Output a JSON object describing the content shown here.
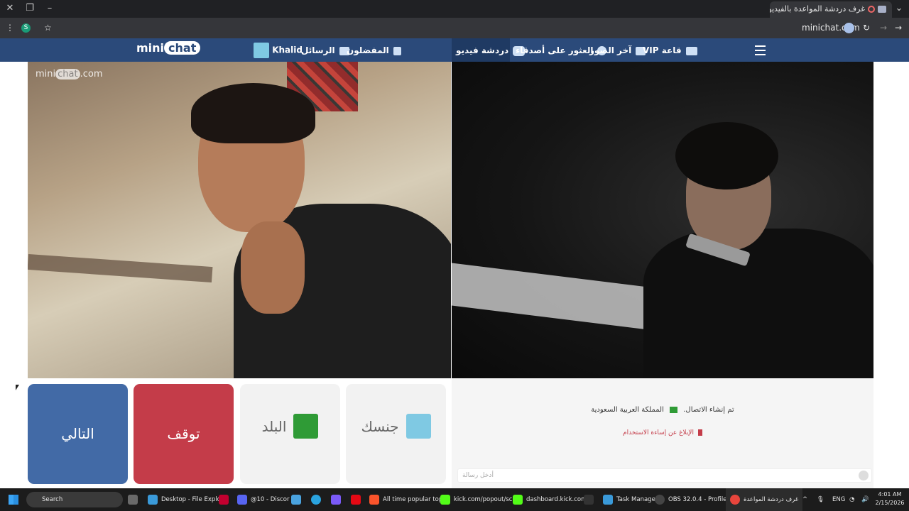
{
  "browser": {
    "tab_title": "غرف دردشة المواعدة بالفيديو",
    "address": "minichat.com",
    "profile_initial": "S"
  },
  "nav": {
    "logo_mini": "mini",
    "logo_chat": "chat",
    "user_name": "Khalid",
    "messages": "الرسائل",
    "favorites": "المفضلون",
    "video_chat": "دردشة فيديو",
    "find_friends": "العثور على أصدقاء",
    "latest_photos": "آخر الصور",
    "vip": "قاعة VIP"
  },
  "video": {
    "watermark_mini": "mini",
    "watermark_chat": "chat",
    "watermark_domain": ".com"
  },
  "controls": {
    "next": "التالي",
    "stop": "توقف",
    "country": "البلد",
    "gender": "جنسك"
  },
  "chat": {
    "status_connected": "تم إنشاء الاتصال.",
    "country_name": "المملكة العربية السعودية",
    "report": "الإبلاغ عن إساءة الاستخدام",
    "input_placeholder": "أدخل رسالة"
  },
  "taskbar": {
    "search": "Search",
    "apps": [
      "Desktop - File Explo",
      "@10 - Discor",
      "All time popular top",
      "kick.com/popout/sc",
      "dashboard.kick.com,",
      "Task Manage",
      "OBS 32.0.4 - Profile:",
      "غرف دردشة المواعدة"
    ],
    "lang": "ENG",
    "time": "4:01 AM",
    "date": "2/15/2026"
  },
  "colors": {
    "nav_bg": "#2b4a7a",
    "next_btn": "#426aa6",
    "stop_btn": "#c43c49",
    "flag_green": "#2f9b36"
  }
}
